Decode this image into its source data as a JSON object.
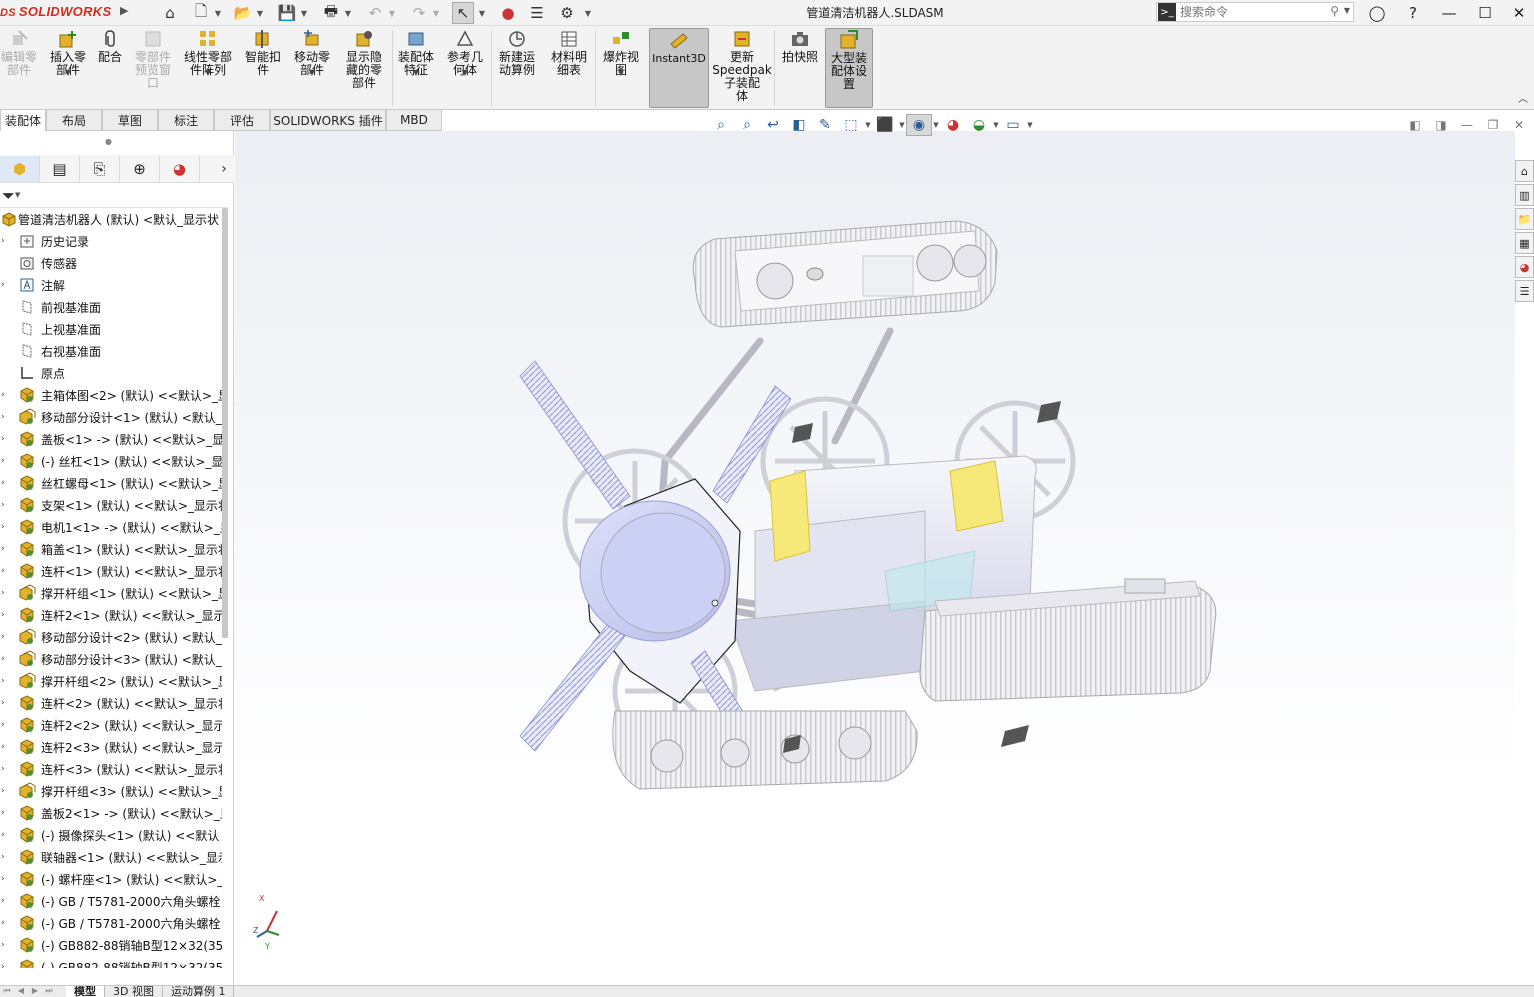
{
  "app": {
    "logo_text": "SOLIDWORKS",
    "logo_prefix": "DS",
    "document_title": "管道清洁机器人.SLDASM"
  },
  "search": {
    "placeholder": "搜索命令"
  },
  "ribbon": {
    "buttons": [
      {
        "label": "编辑零\n部件",
        "icon": "edit-component-icon",
        "enabled": false
      },
      {
        "label": "插入零\n部件",
        "icon": "insert-component-icon",
        "enabled": true
      },
      {
        "label": "配合",
        "icon": "mate-icon",
        "enabled": true
      },
      {
        "label": "零部件\n预览窗\n口",
        "icon": "component-preview-icon",
        "enabled": false
      },
      {
        "label": "线性零部\n件阵列",
        "icon": "linear-pattern-icon",
        "enabled": true
      },
      {
        "label": "智能扣\n件",
        "icon": "smart-fasteners-icon",
        "enabled": true
      },
      {
        "label": "移动零\n部件",
        "icon": "move-component-icon",
        "enabled": true
      },
      {
        "label": "显示隐\n藏的零\n部件",
        "icon": "show-hidden-icon",
        "enabled": true
      },
      {
        "label": "装配体\n特征",
        "icon": "assembly-features-icon",
        "enabled": true
      },
      {
        "label": "参考几\n何体",
        "icon": "reference-geometry-icon",
        "enabled": true
      },
      {
        "label": "新建运\n动算例",
        "icon": "new-motion-study-icon",
        "enabled": true
      },
      {
        "label": "材料明\n细表",
        "icon": "bom-icon",
        "enabled": true
      },
      {
        "label": "爆炸视\n图",
        "icon": "exploded-view-icon",
        "enabled": true
      },
      {
        "label": "Instant3D",
        "icon": "instant3d-icon",
        "enabled": true,
        "active": true
      },
      {
        "label": "更新\nSpeedpak\n子装配\n体",
        "icon": "speedpak-icon",
        "enabled": true
      },
      {
        "label": "拍快照",
        "icon": "snapshot-icon",
        "enabled": true
      },
      {
        "label": "大型装\n配体设\n置",
        "icon": "large-assembly-icon",
        "enabled": true,
        "active": true
      }
    ]
  },
  "command_tabs": [
    "装配体",
    "布局",
    "草图",
    "标注",
    "评估",
    "SOLIDWORKS 插件",
    "MBD"
  ],
  "feature_tree": {
    "root": "管道清洁机器人 (默认) <默认_显示状",
    "items": [
      {
        "label": "历史记录",
        "icon": "history-folder-icon",
        "expandable": true
      },
      {
        "label": "传感器",
        "icon": "sensor-icon",
        "expandable": false
      },
      {
        "label": "注解",
        "icon": "annotation-icon",
        "expandable": true
      },
      {
        "label": "前视基准面",
        "icon": "plane-icon",
        "expandable": false
      },
      {
        "label": "上视基准面",
        "icon": "plane-icon",
        "expandable": false
      },
      {
        "label": "右视基准面",
        "icon": "plane-icon",
        "expandable": false
      },
      {
        "label": "原点",
        "icon": "origin-icon",
        "expandable": false
      },
      {
        "label": "主箱体图<2> (默认) <<默认>_显",
        "icon": "part-icon",
        "expandable": true
      },
      {
        "label": "移动部分设计<1> (默认) <默认_",
        "icon": "subassembly-icon",
        "expandable": true
      },
      {
        "label": "盖板<1> -> (默认) <<默认>_显",
        "icon": "part-icon",
        "expandable": true
      },
      {
        "label": "(-) 丝杠<1> (默认) <<默认>_显",
        "icon": "part-icon",
        "expandable": true
      },
      {
        "label": "丝杠螺母<1> (默认) <<默认>_显",
        "icon": "part-icon",
        "expandable": true
      },
      {
        "label": "支架<1> (默认) <<默认>_显示状",
        "icon": "part-icon",
        "expandable": true
      },
      {
        "label": "电机1<1> -> (默认) <<默认>_显",
        "icon": "part-icon",
        "expandable": true
      },
      {
        "label": "箱盖<1> (默认) <<默认>_显示状",
        "icon": "part-icon",
        "expandable": true
      },
      {
        "label": "连杆<1> (默认) <<默认>_显示状",
        "icon": "part-icon",
        "expandable": true
      },
      {
        "label": "撑开杆组<1> (默认) <<默认>_显",
        "icon": "subassembly-icon",
        "expandable": true
      },
      {
        "label": "连杆2<1> (默认) <<默认>_显示",
        "icon": "part-icon",
        "expandable": true
      },
      {
        "label": "移动部分设计<2> (默认) <默认_",
        "icon": "subassembly-icon",
        "expandable": true
      },
      {
        "label": "移动部分设计<3> (默认) <默认_",
        "icon": "subassembly-icon",
        "expandable": true
      },
      {
        "label": "撑开杆组<2> (默认) <<默认>_显",
        "icon": "subassembly-icon",
        "expandable": true
      },
      {
        "label": "连杆<2> (默认) <<默认>_显示状",
        "icon": "part-icon",
        "expandable": true
      },
      {
        "label": "连杆2<2> (默认) <<默认>_显示",
        "icon": "part-icon",
        "expandable": true
      },
      {
        "label": "连杆2<3> (默认) <<默认>_显示",
        "icon": "part-icon",
        "expandable": true
      },
      {
        "label": "连杆<3> (默认) <<默认>_显示状",
        "icon": "part-icon",
        "expandable": true
      },
      {
        "label": "撑开杆组<3> (默认) <<默认>_显",
        "icon": "subassembly-icon",
        "expandable": true
      },
      {
        "label": "盖板2<1> -> (默认) <<默认>_显",
        "icon": "part-icon",
        "expandable": true
      },
      {
        "label": "(-) 摄像探头<1> (默认) <<默认",
        "icon": "part-icon",
        "expandable": true
      },
      {
        "label": "联轴器<1> (默认) <<默认>_显示",
        "icon": "part-icon",
        "expandable": true
      },
      {
        "label": "(-) 螺杆座<1> (默认) <<默认>_",
        "icon": "part-icon",
        "expandable": true
      },
      {
        "label": "(-) GB / T5781-2000六角头螺栓",
        "icon": "part-icon",
        "expandable": true
      },
      {
        "label": "(-) GB / T5781-2000六角头螺栓",
        "icon": "part-icon",
        "expandable": true
      },
      {
        "label": "(-) GB882-88销轴B型12×32(35",
        "icon": "part-icon",
        "expandable": true
      },
      {
        "label": "(-) GB882-88销轴B型12×32(35",
        "icon": "part-icon",
        "expandable": true
      }
    ]
  },
  "bottom_tabs": [
    "模型",
    "3D 视图",
    "运动算例 1"
  ],
  "triad": {
    "x": "X",
    "y": "Y",
    "z": "Z"
  },
  "colors": {
    "accent_blue": "#2c5c94",
    "logo_red": "#d52b1e",
    "part_yellow": "#e8b820",
    "viewport_top": "#eceef3"
  }
}
